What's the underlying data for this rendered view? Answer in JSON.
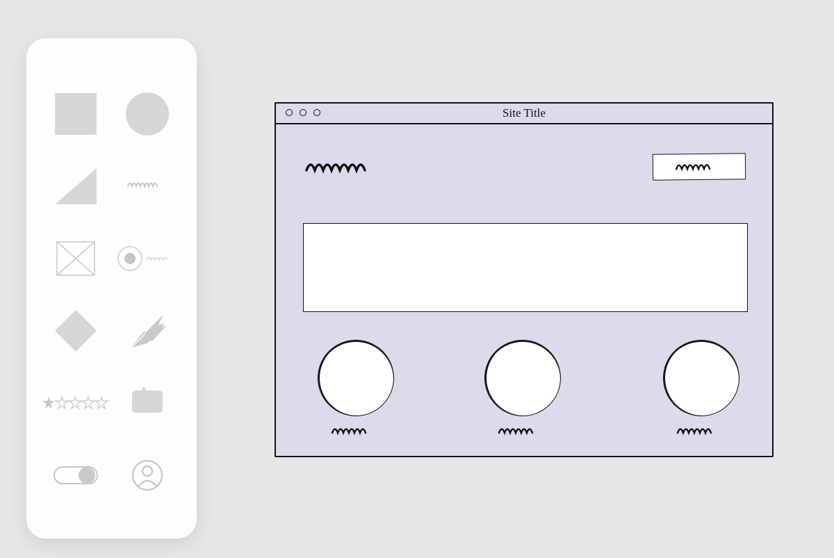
{
  "palette": {
    "shapes": [
      "square",
      "circle",
      "triangle",
      "scribble",
      "image-placeholder",
      "radio-button",
      "diamond",
      "arrow",
      "star-rating",
      "comment-bubble",
      "toggle-switch",
      "avatar"
    ]
  },
  "mock_window": {
    "title": "Site Title",
    "header_scribble": "placeholder-heading",
    "header_button_scribble": "placeholder-button-label",
    "hero": "placeholder-hero",
    "features": [
      {
        "caption": "placeholder-caption-1"
      },
      {
        "caption": "placeholder-caption-2"
      },
      {
        "caption": "placeholder-caption-3"
      }
    ]
  }
}
